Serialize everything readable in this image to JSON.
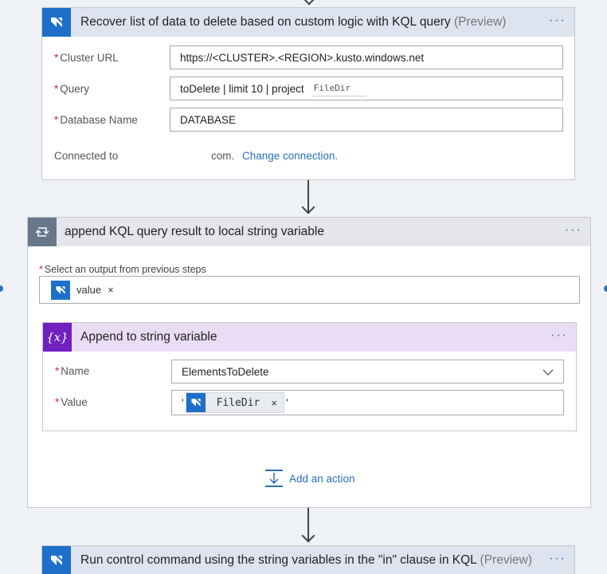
{
  "card1": {
    "title": "Recover list of data to delete based on custom logic with KQL query",
    "preview": "(Preview)",
    "menu": "···",
    "fields": [
      {
        "label": "Cluster URL",
        "value": "https://<CLUSTER>.<REGION>.kusto.windows.net"
      },
      {
        "label": "Query",
        "value": "toDelete | limit 10 | project",
        "token": "FileDir"
      },
      {
        "label": "Database Name",
        "value": "DATABASE"
      }
    ],
    "connected_label": "Connected to",
    "connected_value": "com.",
    "change_connection": "Change connection."
  },
  "foreach": {
    "title": "append KQL query result to local string variable",
    "menu": "···",
    "select_label": "Select an output from previous steps",
    "token": {
      "label": "value",
      "close": "×",
      "icon": "kusto-icon"
    },
    "inner": {
      "title": "Append to string variable",
      "menu": "···",
      "name_label": "Name",
      "name_value": "ElementsToDelete",
      "value_label": "Value",
      "value_prefix": "'",
      "value_suffix": "'",
      "token": {
        "label": "FileDir",
        "close": "×"
      }
    },
    "add_action": "Add an action"
  },
  "card3": {
    "title": "Run control command using the string variables in the \"in\" clause in KQL",
    "preview": "(Preview)",
    "menu": "···"
  },
  "colors": {
    "kusto": "#1e6fc9",
    "variable": "#7121c0",
    "loop": "#68768a",
    "link": "#2a6fc2",
    "required": "#d0252b"
  },
  "icons": [
    "kusto-icon",
    "loop-icon",
    "variable-icon",
    "add-action-icon",
    "chevron-down-icon",
    "close-icon"
  ]
}
